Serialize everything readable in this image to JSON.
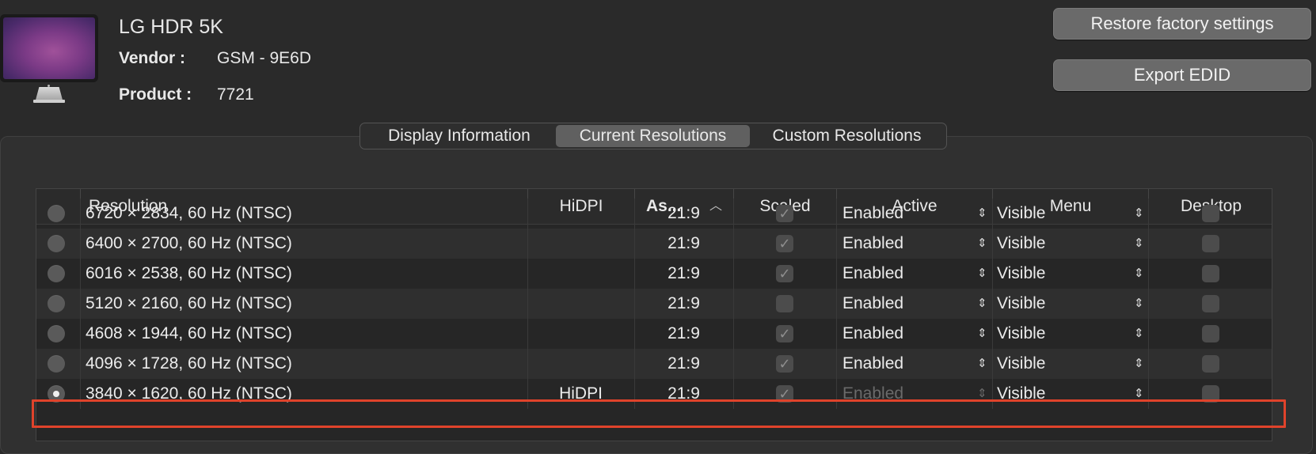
{
  "display": {
    "name": "LG HDR 5K",
    "vendor_label": "Vendor :",
    "vendor_value": "GSM - 9E6D",
    "product_label": "Product :",
    "product_value": "7721"
  },
  "buttons": {
    "restore": "Restore factory settings",
    "export": "Export EDID"
  },
  "tabs": [
    {
      "label": "Display Information",
      "active": false
    },
    {
      "label": "Current Resolutions",
      "active": true
    },
    {
      "label": "Custom Resolutions",
      "active": false
    }
  ],
  "table": {
    "columns": {
      "resolution": "Resolution",
      "hidpi": "HiDPI",
      "aspect": "As...",
      "aspect_sort": "ascending",
      "scaled": "Scaled",
      "active": "Active",
      "menu": "Menu",
      "desktop": "Desktop"
    },
    "rows": [
      {
        "resolution": "6720 × 2834, 60 Hz (NTSC)",
        "hidpi": "",
        "aspect": "21:9",
        "scaled": true,
        "active": "Enabled",
        "menu": "Visible",
        "desktop": false,
        "selected": false
      },
      {
        "resolution": "6400 × 2700, 60 Hz (NTSC)",
        "hidpi": "",
        "aspect": "21:9",
        "scaled": true,
        "active": "Enabled",
        "menu": "Visible",
        "desktop": false,
        "selected": false
      },
      {
        "resolution": "6016 × 2538, 60 Hz (NTSC)",
        "hidpi": "",
        "aspect": "21:9",
        "scaled": true,
        "active": "Enabled",
        "menu": "Visible",
        "desktop": false,
        "selected": false
      },
      {
        "resolution": "5120 × 2160, 60 Hz (NTSC)",
        "hidpi": "",
        "aspect": "21:9",
        "scaled": false,
        "active": "Enabled",
        "menu": "Visible",
        "desktop": false,
        "selected": false
      },
      {
        "resolution": "4608 × 1944, 60 Hz (NTSC)",
        "hidpi": "",
        "aspect": "21:9",
        "scaled": true,
        "active": "Enabled",
        "menu": "Visible",
        "desktop": false,
        "selected": false
      },
      {
        "resolution": "4096 × 1728, 60 Hz (NTSC)",
        "hidpi": "",
        "aspect": "21:9",
        "scaled": true,
        "active": "Enabled",
        "menu": "Visible",
        "desktop": false,
        "selected": false
      },
      {
        "resolution": "3840 × 1620, 60 Hz (NTSC)",
        "hidpi": "HiDPI",
        "aspect": "21:9",
        "scaled": true,
        "active": "Enabled",
        "active_disabled": true,
        "menu": "Visible",
        "desktop": false,
        "selected": true
      }
    ]
  },
  "colors": {
    "highlight_border": "#e0432b",
    "background": "#2a2a2a"
  }
}
